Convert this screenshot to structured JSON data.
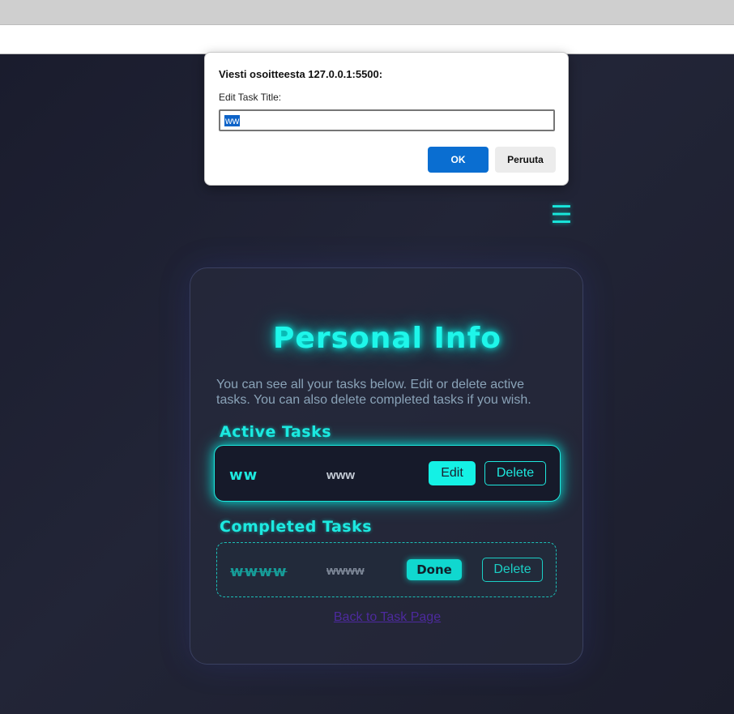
{
  "dialog": {
    "title": "Viesti osoitteesta 127.0.0.1:5500:",
    "label": "Edit Task Title:",
    "input_value": "ww",
    "ok_label": "OK",
    "cancel_label": "Peruuta"
  },
  "nav": {
    "menu_glyph": "☰"
  },
  "card": {
    "title": "Personal Info",
    "description": "You can see all your tasks below. Edit or delete active tasks. You can also delete completed tasks if you wish.",
    "active_heading": "Active Tasks",
    "active_task": {
      "title": "ww",
      "description": "www",
      "edit_label": "Edit",
      "delete_label": "Delete"
    },
    "completed_heading": "Completed Tasks",
    "completed_task": {
      "title": "wwww",
      "description": "wwww",
      "done_label": "Done",
      "delete_label": "Delete"
    },
    "back_link": "Back to Task Page"
  },
  "colors": {
    "accent": "#1ee8de",
    "background": "#1d2030",
    "link": "#4d2a9e",
    "dialog_primary": "#0a6ed1"
  }
}
